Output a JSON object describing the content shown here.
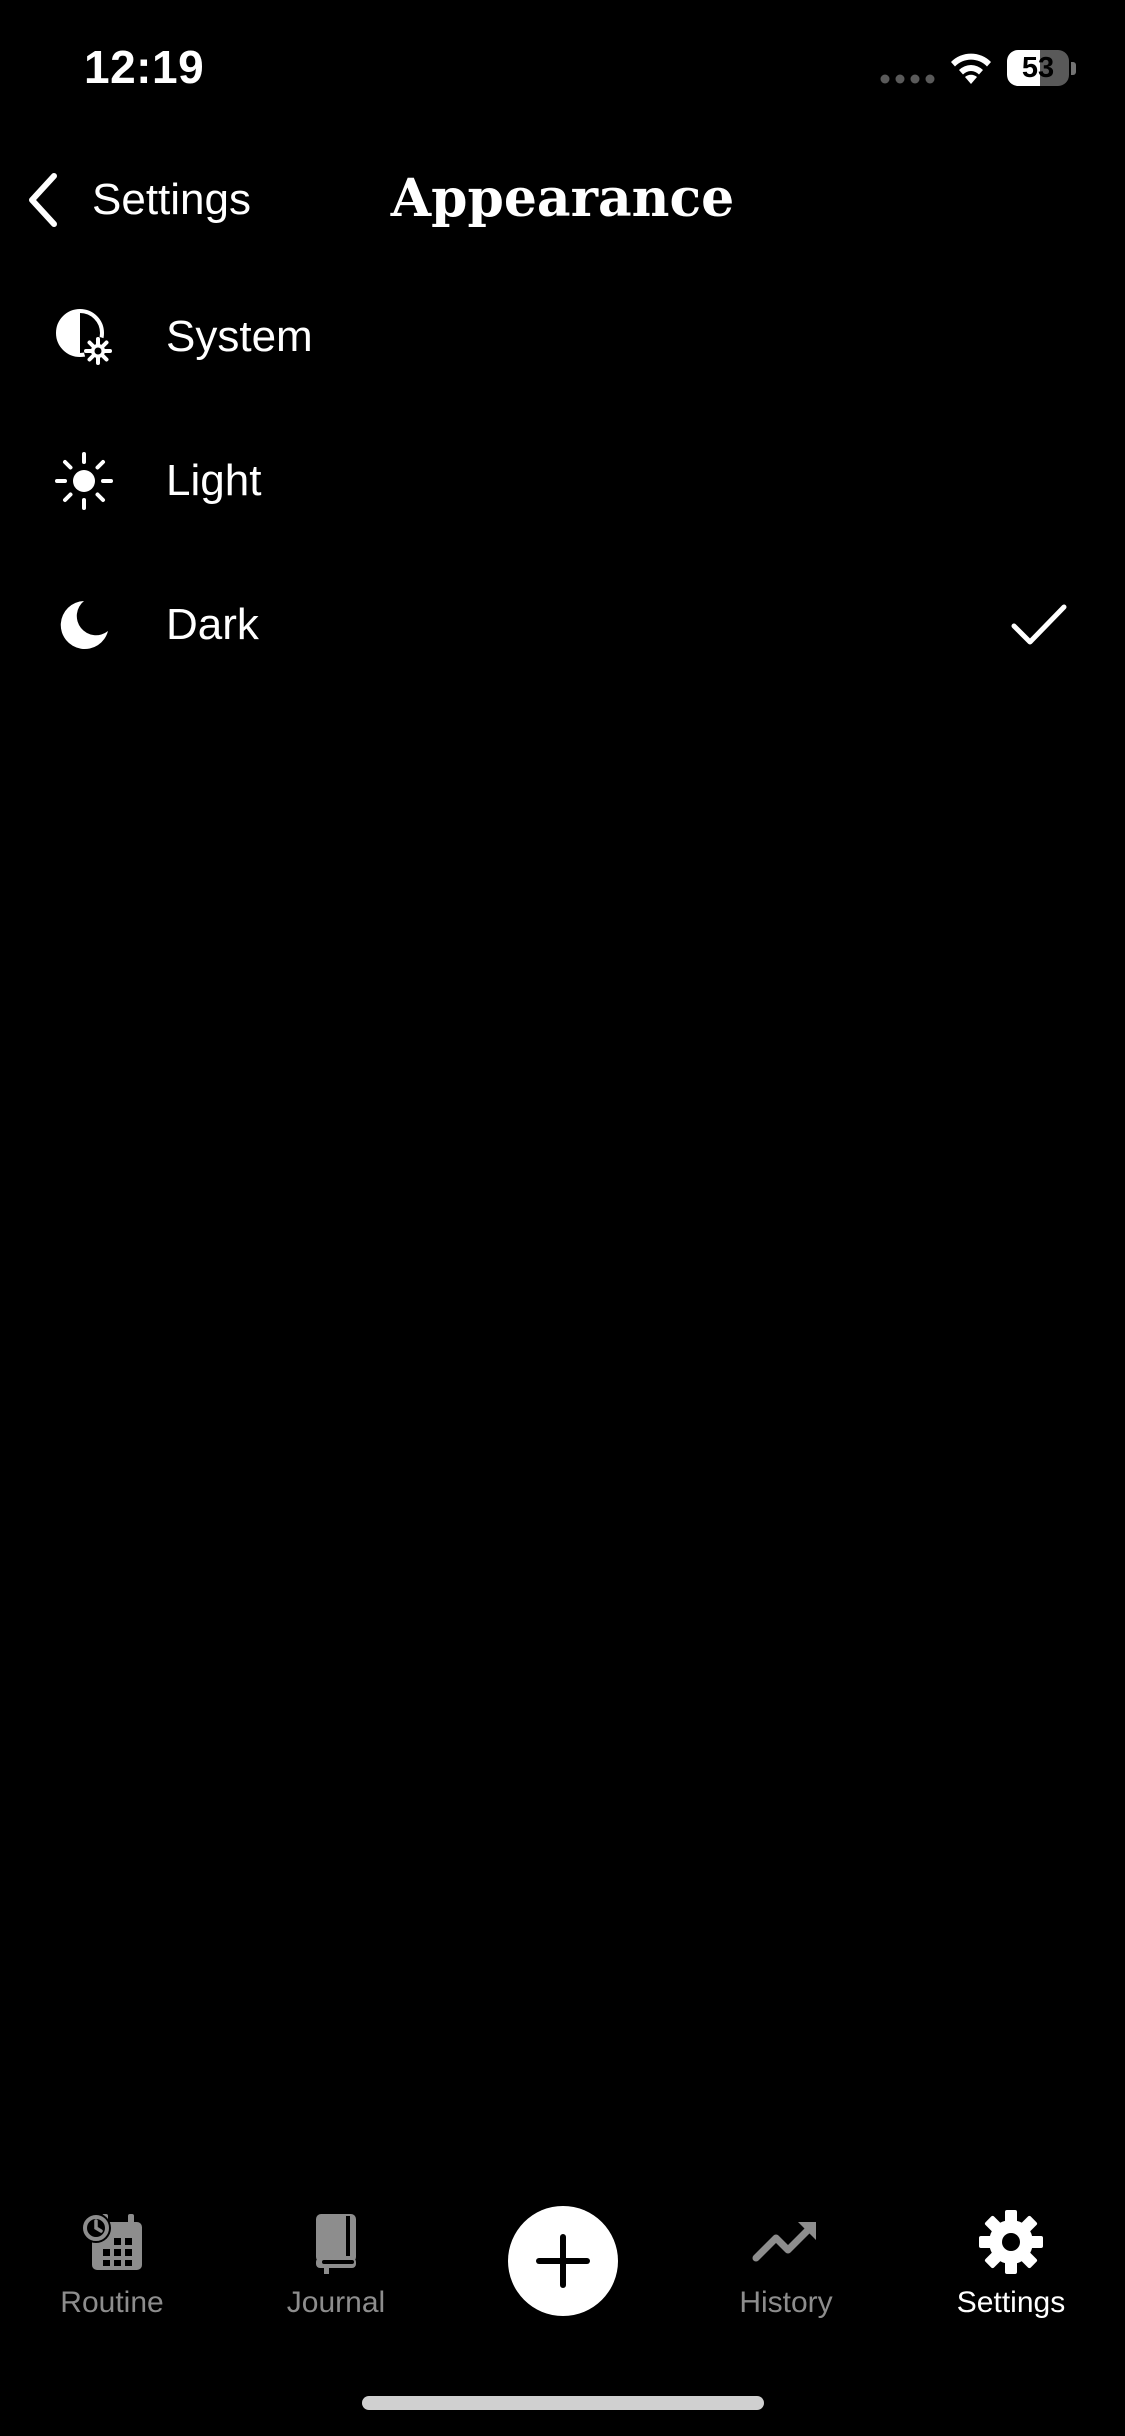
{
  "status_bar": {
    "time": "12:19",
    "battery_level": 53,
    "battery_text": "53"
  },
  "nav": {
    "back_label": "Settings",
    "title": "Appearance"
  },
  "appearance_options": [
    {
      "label": "System",
      "icon": "system-theme-icon",
      "selected": false
    },
    {
      "label": "Light",
      "icon": "sun-icon",
      "selected": false
    },
    {
      "label": "Dark",
      "icon": "moon-icon",
      "selected": true
    }
  ],
  "tab_bar": {
    "items": [
      {
        "label": "Routine",
        "icon": "calendar-clock-icon",
        "active": false
      },
      {
        "label": "Journal",
        "icon": "book-icon",
        "active": false
      },
      {
        "label": "History",
        "icon": "trend-up-icon",
        "active": false
      },
      {
        "label": "Settings",
        "icon": "gear-icon",
        "active": true
      }
    ],
    "add_icon": "plus-icon"
  },
  "colors": {
    "background": "#000000",
    "text": "#ffffff",
    "inactive_tab": "#8d8d8d",
    "home_indicator": "#d0d0d0"
  }
}
